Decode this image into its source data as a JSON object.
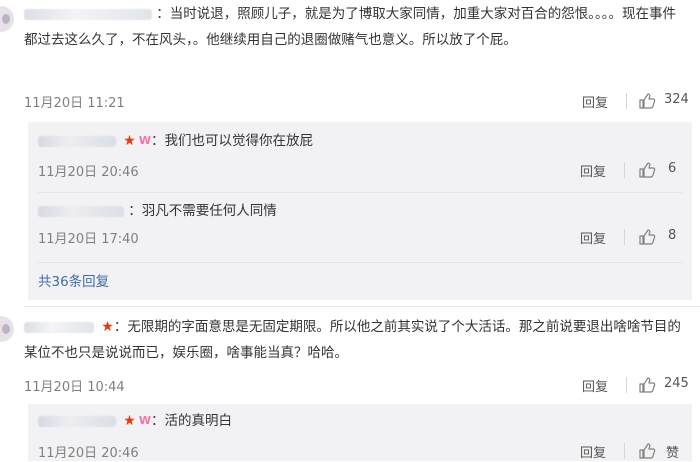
{
  "comments": [
    {
      "username": "哈萨萨欧茜茜",
      "text": "：当时说退，照顾儿子，就是为了博取大家同情，加重大家对百合的怨恨。。。。现在事件都过去这么久了，不在风头，。他继续用自己的退圈做赌气也意义。所以放了个屁。",
      "time": "11月20日 11:21",
      "reply_label": "回复",
      "likes": "324",
      "replies": [
        {
          "username": "…",
          "text": "：我们也可以觉得你在放屁",
          "time": "11月20日 20:46",
          "reply_label": "回复",
          "likes": "6"
        },
        {
          "username": "…啦",
          "text": "：羽凡不需要任何人同情",
          "time": "11月20日 17:40",
          "reply_label": "回复",
          "likes": "8"
        }
      ],
      "more_replies": "共36条回复"
    },
    {
      "username": "…",
      "text": "：无限期的字面意思是无固定期限。所以他之前其实说了个大活话。那之前说要退出啥啥节目的某位不也只是说说而已，娱乐圈，啥事能当真？哈哈。",
      "time": "11月20日 10:44",
      "reply_label": "回复",
      "likes": "245",
      "replies": [
        {
          "username": "…",
          "text": "：活的真明白",
          "time": "11月20日 20:46",
          "reply_label": "回复",
          "likes": "赞"
        }
      ]
    }
  ],
  "icons": {
    "star": "★",
    "vip_badge": "W",
    "thumb": "thumb-up-icon"
  },
  "colors": {
    "username": "#3c6ea8",
    "star": "#e8380d",
    "vip": "#ff6fa6",
    "subbox": "#f2f2f5"
  }
}
